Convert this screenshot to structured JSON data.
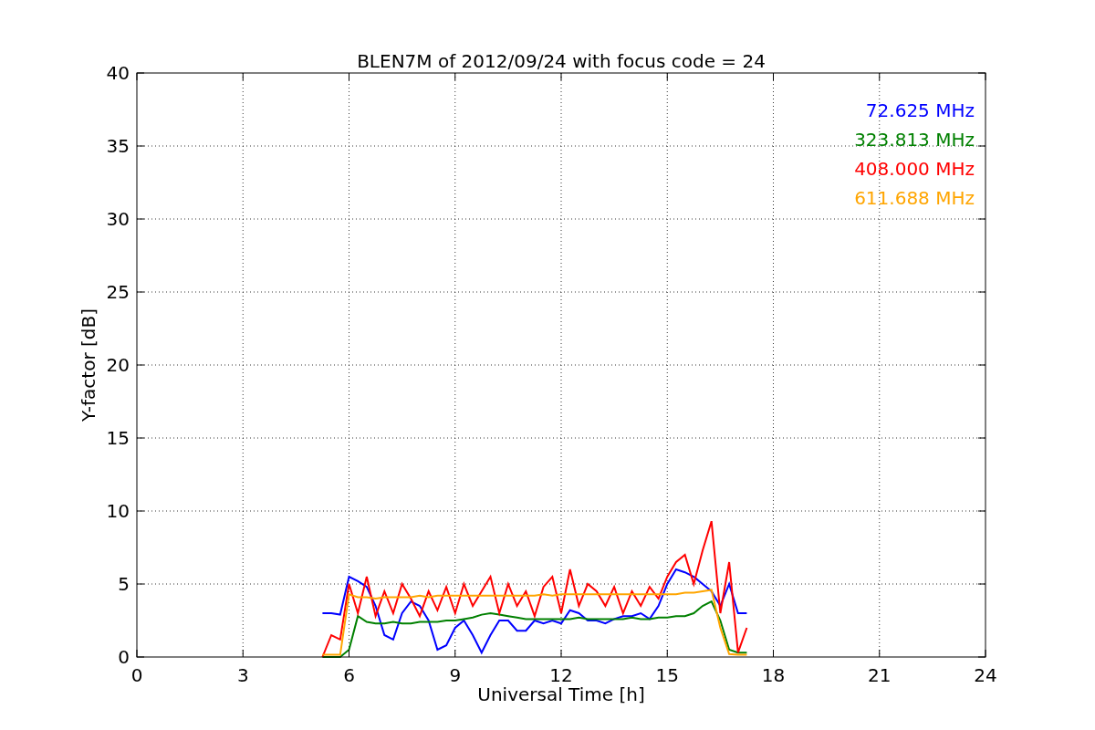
{
  "chart_data": {
    "type": "line",
    "title": "BLEN7M of 2012/09/24 with focus code = 24",
    "xlabel": "Universal Time [h]",
    "ylabel": "Y-factor [dB]",
    "x": [
      5.25,
      5.5,
      5.75,
      6,
      6.25,
      6.5,
      6.75,
      7,
      7.25,
      7.5,
      7.75,
      8,
      8.25,
      8.5,
      8.75,
      9,
      9.25,
      9.5,
      9.75,
      10,
      10.25,
      10.5,
      10.75,
      11,
      11.25,
      11.5,
      11.75,
      12,
      12.25,
      12.5,
      12.75,
      13,
      13.25,
      13.5,
      13.75,
      14,
      14.25,
      14.5,
      14.75,
      15,
      15.25,
      15.5,
      15.75,
      16,
      16.25,
      16.5,
      16.75,
      17,
      17.25
    ],
    "series": [
      {
        "name": "72.625 MHz",
        "color": "#0000ff",
        "values": [
          3,
          3,
          2.9,
          5.5,
          5.2,
          4.8,
          3.5,
          1.5,
          1.2,
          3,
          3.8,
          3.5,
          2.5,
          0.5,
          0.8,
          2,
          2.5,
          1.5,
          0.3,
          1.5,
          2.5,
          2.5,
          1.8,
          1.8,
          2.5,
          2.3,
          2.5,
          2.3,
          3.2,
          3,
          2.5,
          2.5,
          2.3,
          2.6,
          2.8,
          2.8,
          3,
          2.6,
          3.5,
          5,
          6,
          5.8,
          5.5,
          5,
          4.5,
          3.5,
          5,
          3,
          3
        ]
      },
      {
        "name": "323.813 MHz",
        "color": "#008000",
        "values": [
          0,
          0,
          0,
          0.5,
          2.8,
          2.4,
          2.3,
          2.3,
          2.4,
          2.3,
          2.3,
          2.4,
          2.4,
          2.4,
          2.5,
          2.5,
          2.6,
          2.7,
          2.9,
          3,
          2.9,
          2.8,
          2.7,
          2.6,
          2.6,
          2.6,
          2.6,
          2.6,
          2.6,
          2.7,
          2.6,
          2.6,
          2.6,
          2.6,
          2.6,
          2.7,
          2.6,
          2.6,
          2.7,
          2.7,
          2.8,
          2.8,
          3,
          3.5,
          3.8,
          2.5,
          0.5,
          0.3,
          0.3
        ]
      },
      {
        "name": "408.000 MHz",
        "color": "#ff0000",
        "values": [
          0,
          1.5,
          1.2,
          5,
          3,
          5.5,
          2.8,
          4.5,
          3,
          5,
          4,
          2.8,
          4.5,
          3.2,
          4.8,
          3,
          5,
          3.5,
          4.5,
          5.5,
          3,
          5,
          3.5,
          4.5,
          2.8,
          4.8,
          5.5,
          3,
          6,
          3.5,
          5,
          4.5,
          3.5,
          4.8,
          3,
          4.5,
          3.5,
          4.8,
          4,
          5.5,
          6.5,
          7,
          5,
          7.3,
          9.3,
          3,
          6.5,
          0.3,
          2
        ]
      },
      {
        "name": "611.688 MHz",
        "color": "#ffa500",
        "values": [
          0.15,
          0.15,
          0.15,
          4.3,
          4.1,
          4.1,
          4,
          4.1,
          4.1,
          4.1,
          4.1,
          4.2,
          4.1,
          4.2,
          4.2,
          4.2,
          4.2,
          4.2,
          4.2,
          4.2,
          4.2,
          4.2,
          4.2,
          4.2,
          4.2,
          4.3,
          4.2,
          4.3,
          4.3,
          4.3,
          4.3,
          4.3,
          4.3,
          4.3,
          4.3,
          4.3,
          4.3,
          4.3,
          4.3,
          4.3,
          4.3,
          4.4,
          4.4,
          4.5,
          4.6,
          2,
          0.2,
          0.15,
          0.15
        ]
      }
    ],
    "grid": true,
    "xlim": [
      0,
      24
    ],
    "ylim": [
      0,
      40
    ],
    "xticks": [
      0,
      3,
      6,
      9,
      12,
      15,
      18,
      21,
      24
    ],
    "yticks": [
      0,
      5,
      10,
      15,
      20,
      25,
      30,
      35,
      40
    ]
  }
}
